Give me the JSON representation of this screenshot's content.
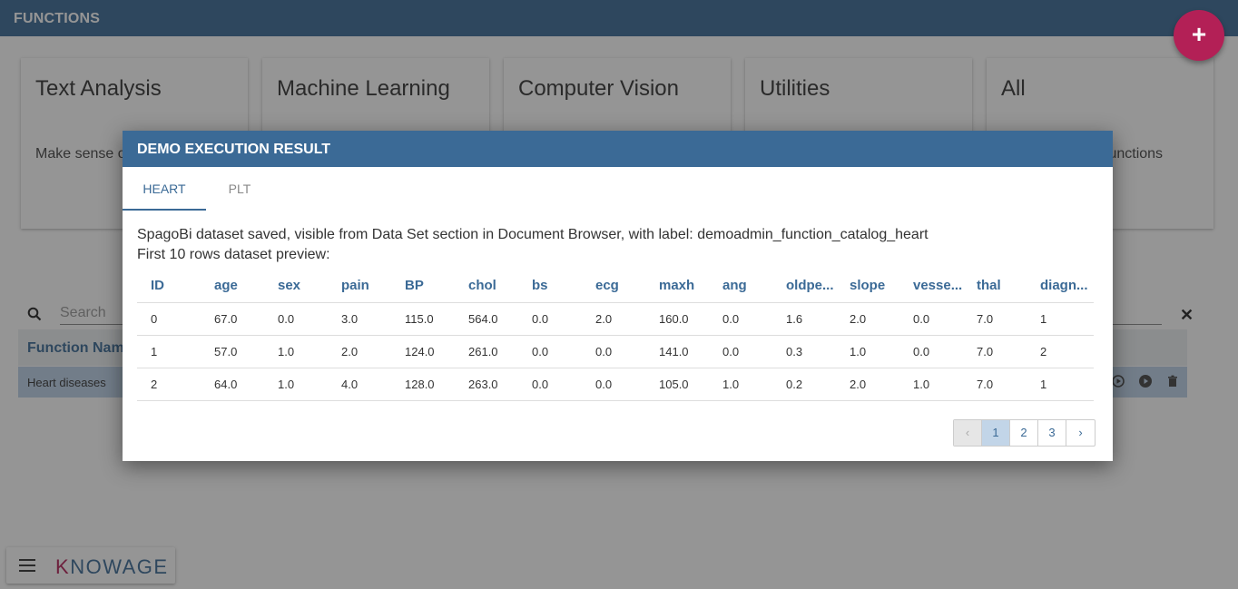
{
  "app": {
    "title": "FUNCTIONS",
    "fab_label": "+"
  },
  "categories": [
    {
      "title": "Text Analysis",
      "desc": "Make sense of text"
    },
    {
      "title": "Machine Learning",
      "desc": ""
    },
    {
      "title": "Computer Vision",
      "desc": ""
    },
    {
      "title": "Utilities",
      "desc": ""
    },
    {
      "title": "All",
      "desc": "functions"
    }
  ],
  "search": {
    "placeholder": "Search",
    "value": ""
  },
  "function_table": {
    "header": "Function Name",
    "rows": [
      {
        "name": "Heart diseases"
      }
    ]
  },
  "logo": {
    "first": "K",
    "rest": "NOWAGE"
  },
  "dialog": {
    "title": "DEMO EXECUTION RESULT",
    "tabs": [
      "HEART",
      "PLT"
    ],
    "message": "SpagoBi dataset saved, visible from Data Set section in Document Browser, with label: demoadmin_function_catalog_heart",
    "preview_label": "First 10 rows dataset preview:",
    "columns": [
      "ID",
      "age",
      "sex",
      "pain",
      "BP",
      "chol",
      "bs",
      "ecg",
      "maxh",
      "ang",
      "oldpe...",
      "slope",
      "vesse...",
      "thal",
      "diagn..."
    ],
    "rows": [
      [
        "0",
        "67.0",
        "0.0",
        "3.0",
        "115.0",
        "564.0",
        "0.0",
        "2.0",
        "160.0",
        "0.0",
        "1.6",
        "2.0",
        "0.0",
        "7.0",
        "1"
      ],
      [
        "1",
        "57.0",
        "1.0",
        "2.0",
        "124.0",
        "261.0",
        "0.0",
        "0.0",
        "141.0",
        "0.0",
        "0.3",
        "1.0",
        "0.0",
        "7.0",
        "2"
      ],
      [
        "2",
        "64.0",
        "1.0",
        "4.0",
        "128.0",
        "263.0",
        "0.0",
        "0.0",
        "105.0",
        "1.0",
        "0.2",
        "2.0",
        "1.0",
        "7.0",
        "1"
      ]
    ],
    "pagination": {
      "prev": "‹",
      "pages": [
        "1",
        "2",
        "3"
      ],
      "next": "›",
      "current": "1"
    }
  },
  "colors": {
    "primary": "#3b6a96",
    "accent": "#b32056",
    "row_selected": "#bcd2e8"
  }
}
